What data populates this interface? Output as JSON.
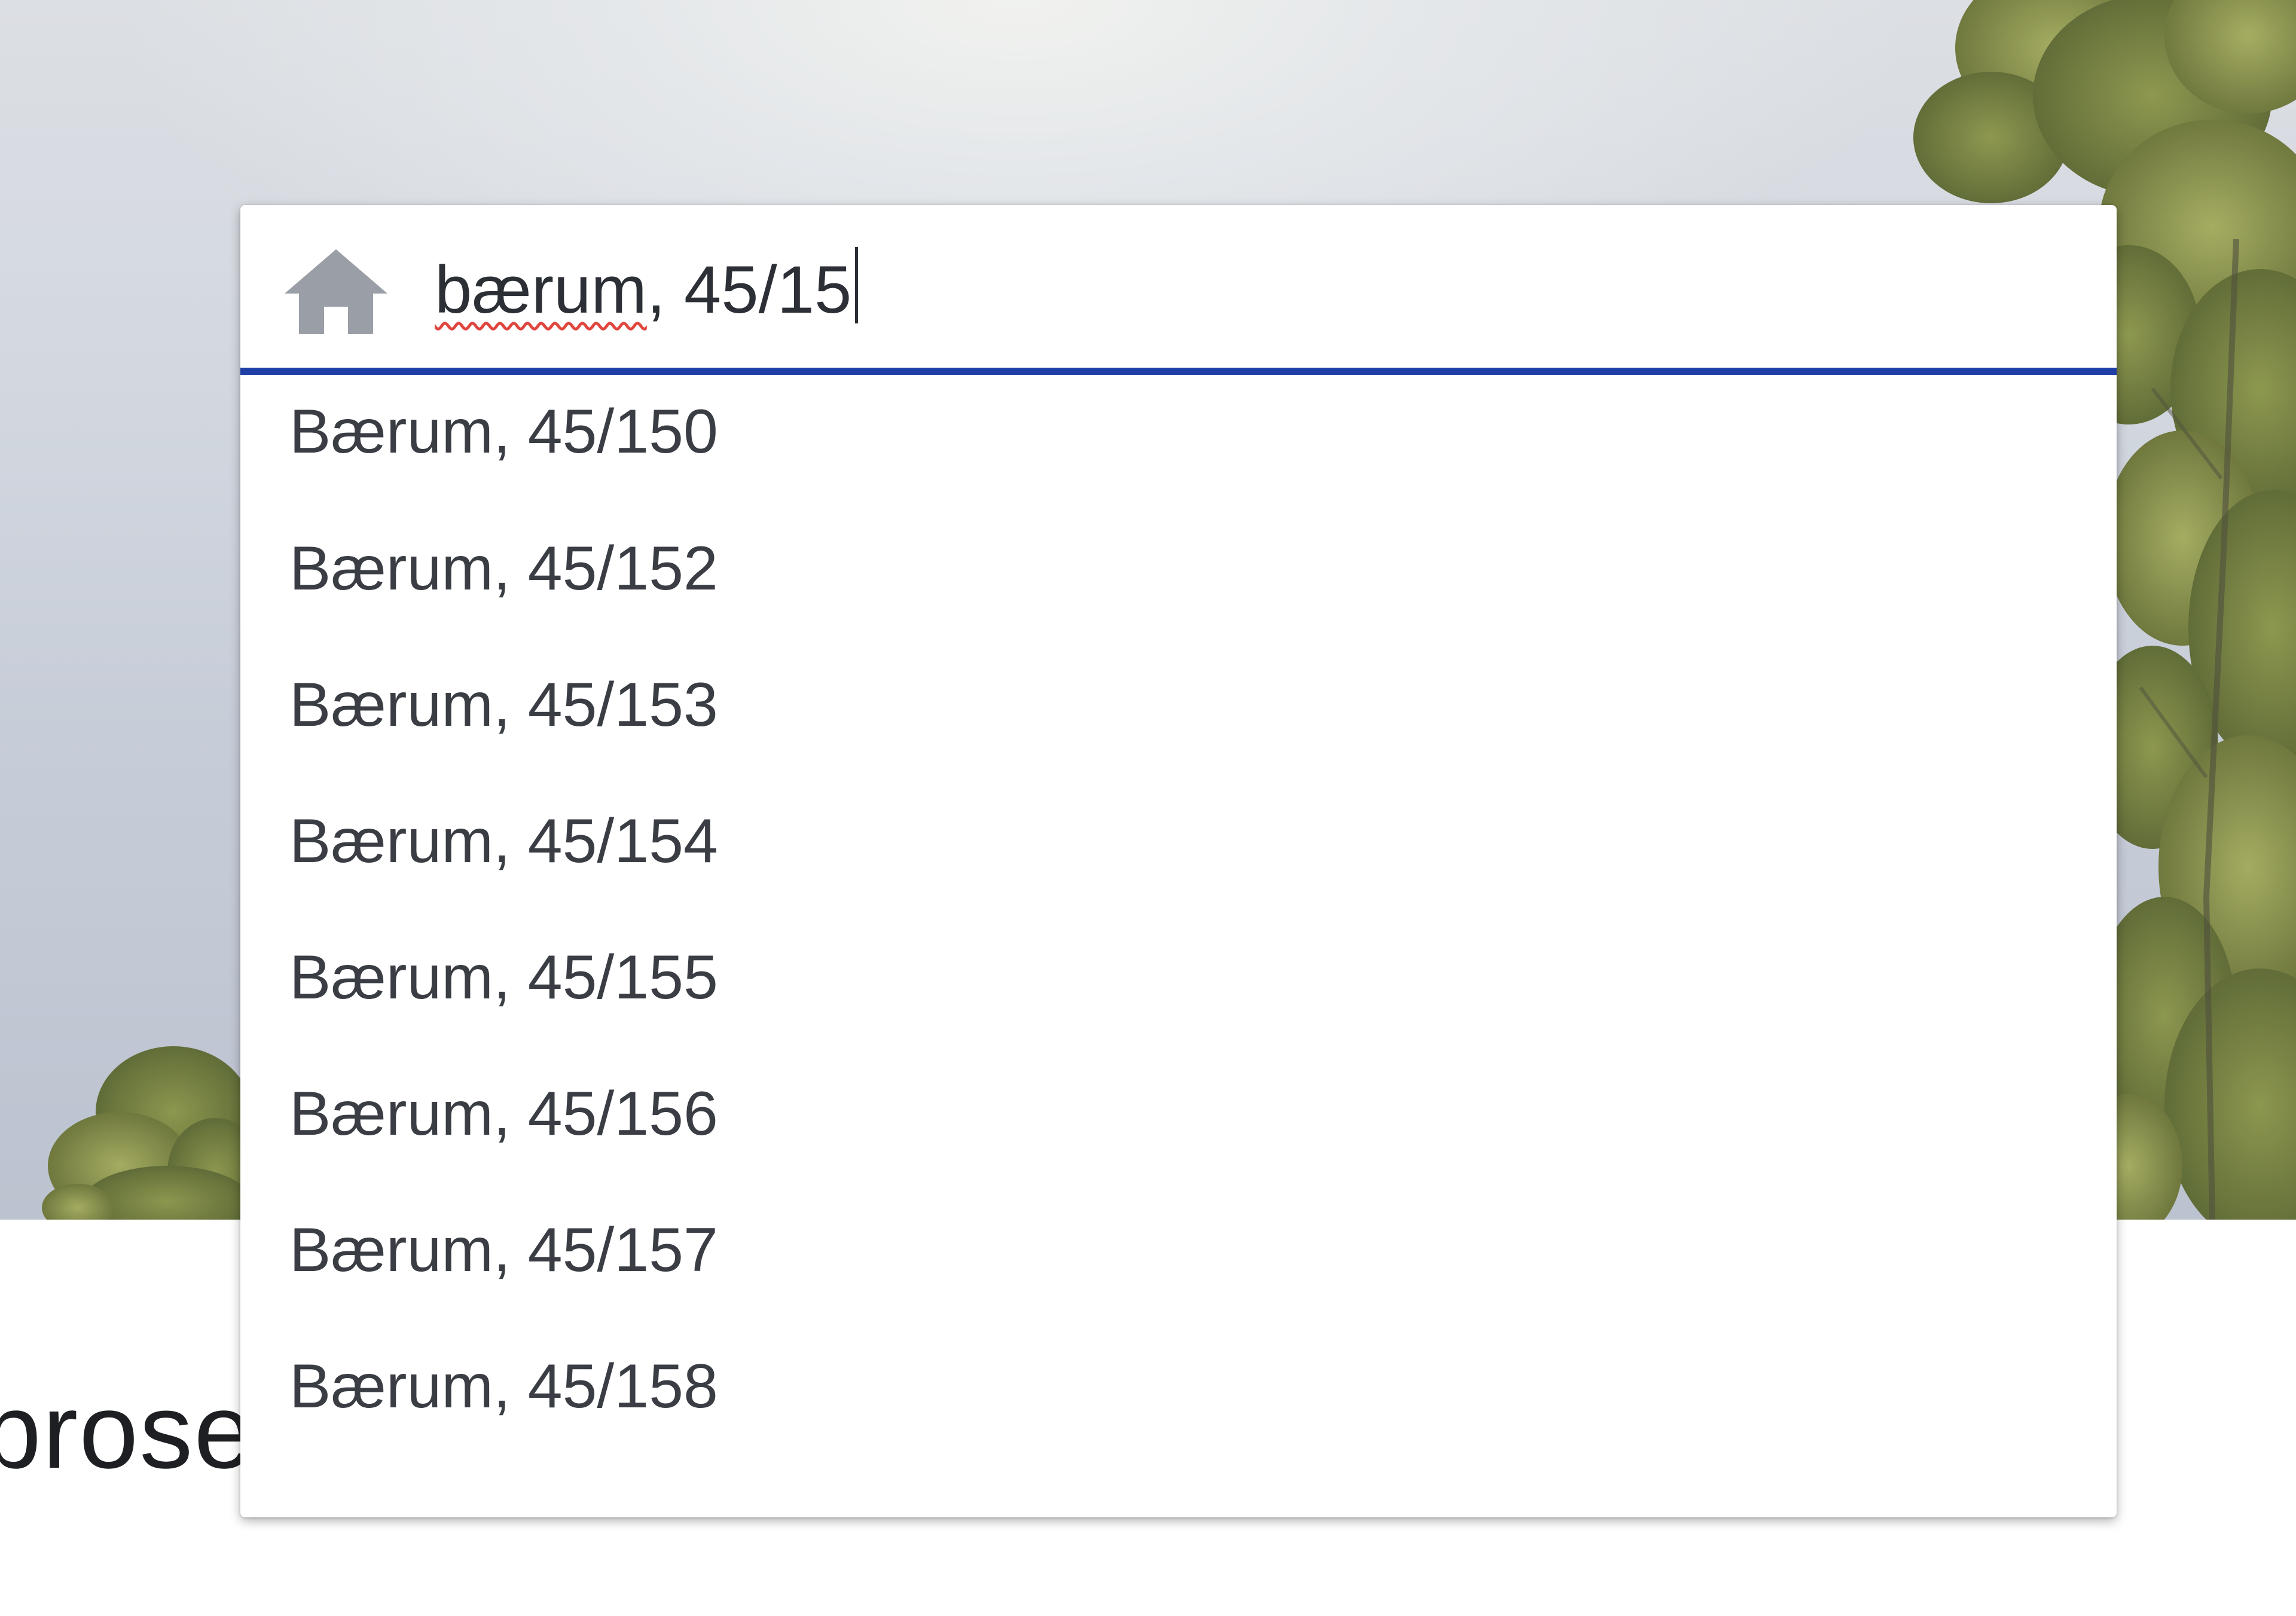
{
  "hero": {
    "background_colors": {
      "sky_top": "#e8eae8",
      "sky_bottom": "#bcc3d0",
      "foliage": "#6f7a3a"
    }
  },
  "page": {
    "partial_heading": "prose"
  },
  "search": {
    "icon": "home-icon",
    "value_typed": "bærum",
    "value_rest": ", 45/15",
    "accent_color": "#1f3fa6",
    "suggestions": [
      "Bærum, 45/150",
      "Bærum, 45/152",
      "Bærum, 45/153",
      "Bærum, 45/154",
      "Bærum, 45/155",
      "Bærum, 45/156",
      "Bærum, 45/157",
      "Bærum, 45/158"
    ]
  }
}
